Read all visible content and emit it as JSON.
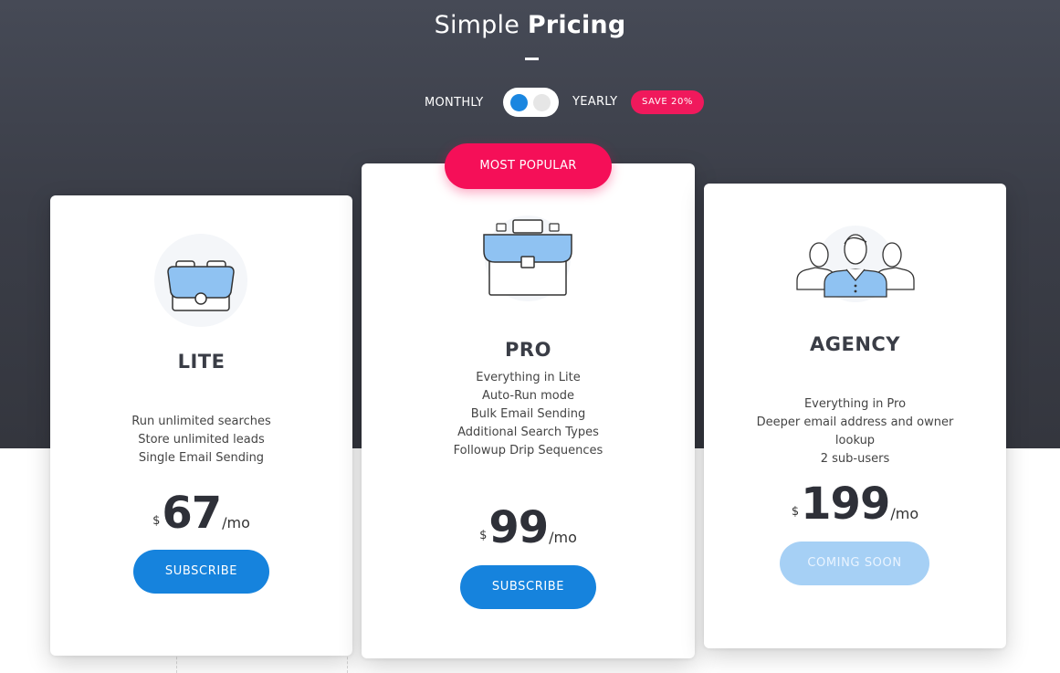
{
  "header": {
    "title_light": "Simple",
    "title_bold": "Pricing"
  },
  "billing": {
    "monthly_label": "MONTHLY",
    "yearly_label": "YEARLY",
    "save_badge": "SAVE 20%",
    "selected": "monthly"
  },
  "colors": {
    "accent_blue": "#1683dd",
    "accent_pink": "#f50f58",
    "dark_bg": "#3b3e48",
    "icon_fill": "#8fc2f2"
  },
  "plans": [
    {
      "name": "LITE",
      "icon": "bag-icon",
      "features": [
        "Run unlimited searches",
        "Store unlimited leads",
        "Single Email Sending"
      ],
      "currency": "$",
      "amount": "67",
      "period": "/mo",
      "button_label": "SUBSCRIBE",
      "button_enabled": true
    },
    {
      "name": "PRO",
      "badge": "MOST POPULAR",
      "icon": "briefcase-icon",
      "features": [
        "Everything in Lite",
        "Auto-Run mode",
        "Bulk Email Sending",
        "Additional Search Types",
        "Followup Drip Sequences"
      ],
      "currency": "$",
      "amount": "99",
      "period": "/mo",
      "button_label": "SUBSCRIBE",
      "button_enabled": true
    },
    {
      "name": "AGENCY",
      "icon": "team-icon",
      "features": [
        "Everything in Pro",
        "Deeper email address and owner",
        "lookup",
        "2 sub-users"
      ],
      "currency": "$",
      "amount": "199",
      "period": "/mo",
      "button_label": "COMING SOON",
      "button_enabled": false
    }
  ]
}
